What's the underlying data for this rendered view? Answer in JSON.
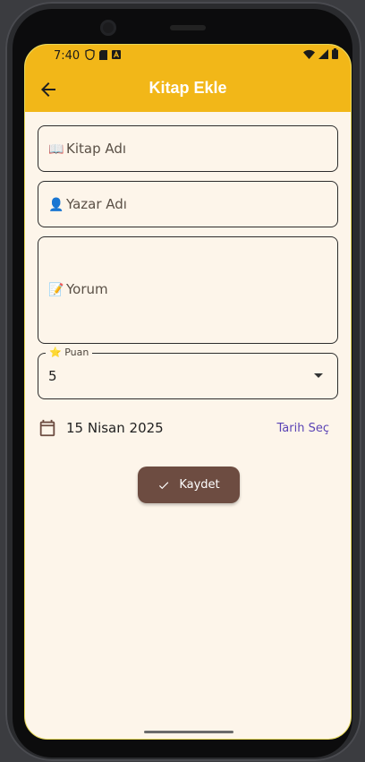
{
  "status_bar": {
    "time": "7:40",
    "icons": [
      "shield-icon",
      "sim-card-icon",
      "a-badge-icon",
      "wifi-icon",
      "signal-icon",
      "battery-icon"
    ]
  },
  "app_bar": {
    "title": "Kitap Ekle",
    "back_icon": "arrow-back-icon",
    "background": "#f2b718"
  },
  "form": {
    "book_name": {
      "emoji": "📖",
      "placeholder": "Kitap Adı"
    },
    "author_name": {
      "emoji": "👤",
      "placeholder": "Yazar Adı"
    },
    "comment": {
      "emoji": "📝",
      "placeholder": "Yorum"
    },
    "rating": {
      "emoji": "⭐",
      "label": "Puan",
      "value": "5"
    },
    "date": {
      "value": "15 Nisan 2025",
      "pick_label": "Tarih Seç"
    },
    "save_label": "Kaydet"
  },
  "colors": {
    "accent": "#f2b718",
    "background": "#fdf5ea",
    "button": "#6d4c41",
    "link": "#5b44b5"
  }
}
